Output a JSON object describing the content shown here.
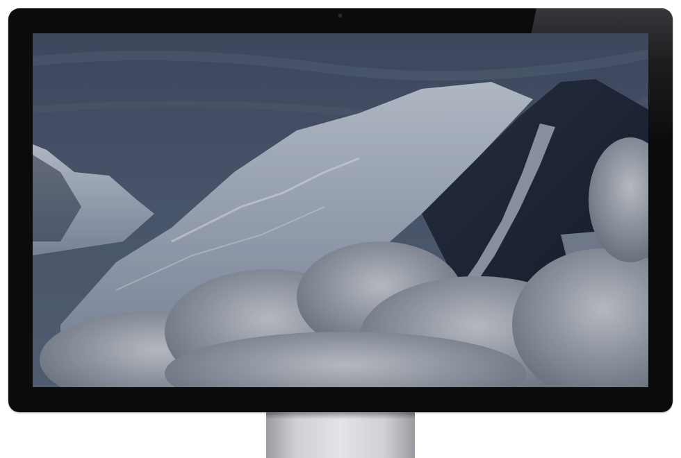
{
  "scene": {
    "device": "monitor-display",
    "wallpaper": "snowy-mountain-peaks-above-clouds",
    "colors": {
      "bezel": "#0b0b0c",
      "sky_top": "#4a566b",
      "sky_bottom": "#5d6a80",
      "snow": "#c9d2e0",
      "rock": "#1c2436",
      "cloud": "#c6cbd3",
      "stand": "#d6d7da"
    }
  }
}
